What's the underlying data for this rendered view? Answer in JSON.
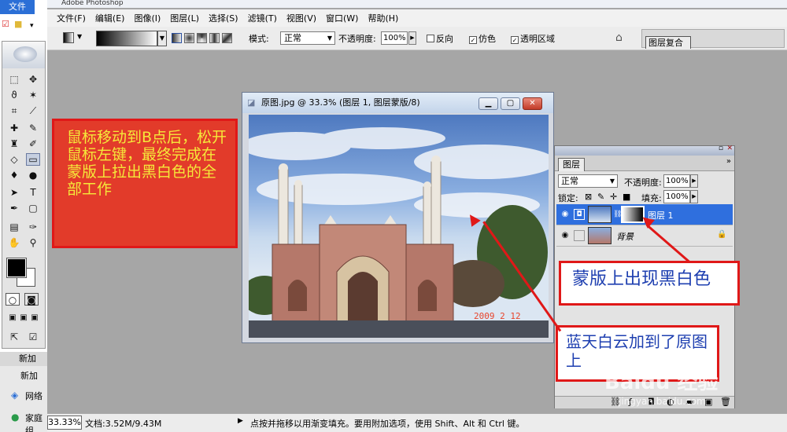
{
  "app": {
    "title": "Adobe Photoshop"
  },
  "explorer": {
    "file_tab": "文件",
    "items": [
      "新加",
      "新加",
      "网络",
      "家庭组"
    ]
  },
  "menu": [
    "文件(F)",
    "编辑(E)",
    "图像(I)",
    "图层(L)",
    "选择(S)",
    "滤镜(T)",
    "视图(V)",
    "窗口(W)",
    "帮助(H)"
  ],
  "options": {
    "mode_label": "模式:",
    "mode_value": "正常",
    "opacity_label": "不透明度:",
    "opacity_value": "100%",
    "reverse": "反向",
    "dither": "仿色",
    "transparency": "透明区域",
    "palette_tab": "图层复合"
  },
  "document": {
    "title": "原图.jpg @ 33.3% (图层 1, 图层蒙版/8)",
    "date_stamp": "2009   2  12"
  },
  "layers_panel": {
    "tab": "图层",
    "blend_mode": "正常",
    "opacity_label": "不透明度:",
    "opacity_value": "100%",
    "lock_label": "锁定:",
    "fill_label": "填充:",
    "fill_value": "100%",
    "layers": [
      {
        "name": "图层 1",
        "selected": true
      },
      {
        "name": "背景",
        "selected": false
      }
    ]
  },
  "annotations": {
    "left_note": "鼠标移动到B点后，松开鼠标左键，最终完成在蒙版上拉出黑白色的全部工作",
    "mask_note": "蒙版上出现黑白色",
    "sky_note": "蓝天白云加到了原图上"
  },
  "status": {
    "zoom": "33.33%",
    "doc_size": "文档:3.52M/9.43M",
    "hint": "点按并拖移以用渐变填充。要用附加选项，使用 Shift、Alt 和 Ctrl 键。"
  },
  "watermark": {
    "text": "Baidu 经验",
    "url": "jingyan.baidu.com"
  },
  "colors": {
    "annotation_red": "#e01818",
    "note_yellow": "#f5e93a",
    "note_blue": "#1e3fb0",
    "selection_blue": "#2f6fde"
  }
}
